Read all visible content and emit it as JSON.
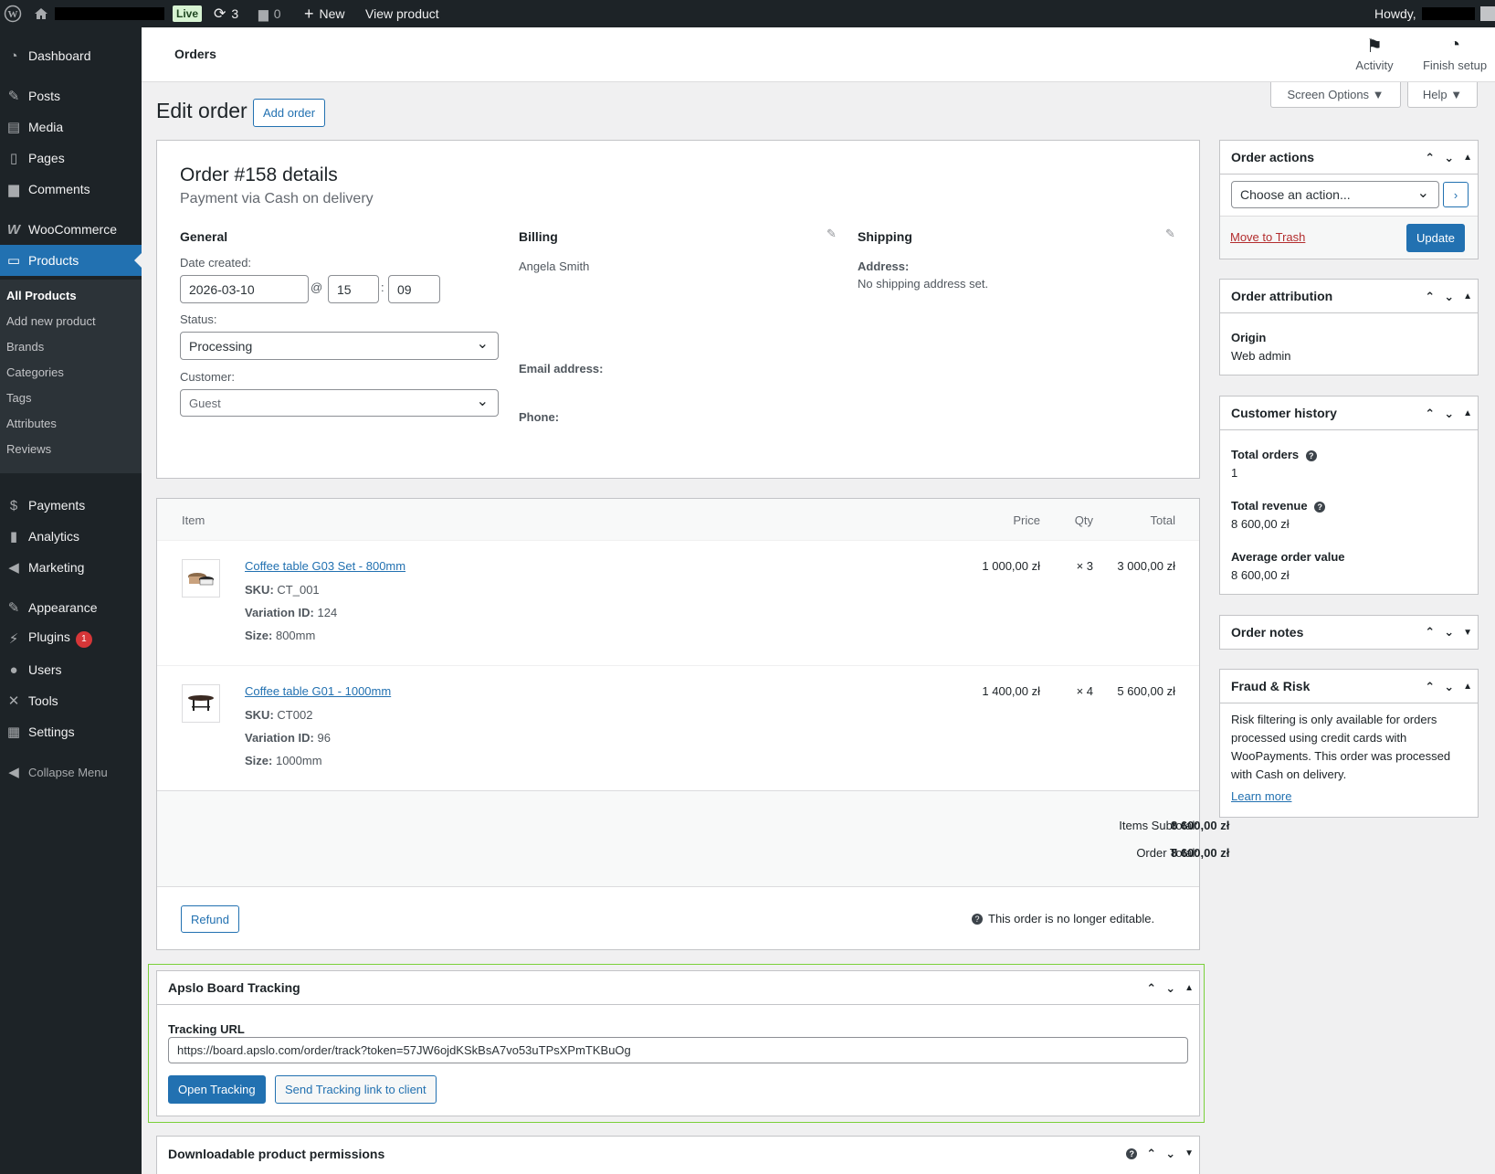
{
  "adminbar": {
    "live_label": "Live",
    "updates_count": "3",
    "comments_count": "0",
    "new_label": "New",
    "view_product_label": "View product",
    "howdy_label": "Howdy,"
  },
  "sidebar": {
    "dashboard": "Dashboard",
    "posts": "Posts",
    "media": "Media",
    "pages": "Pages",
    "comments": "Comments",
    "woocommerce": "WooCommerce",
    "products": "Products",
    "submenu": {
      "all_products": "All Products",
      "add_new": "Add new product",
      "brands": "Brands",
      "categories": "Categories",
      "tags": "Tags",
      "attributes": "Attributes",
      "reviews": "Reviews"
    },
    "payments": "Payments",
    "analytics": "Analytics",
    "marketing": "Marketing",
    "appearance": "Appearance",
    "plugins": "Plugins",
    "plugins_badge": "1",
    "users": "Users",
    "tools": "Tools",
    "settings": "Settings",
    "collapse": "Collapse Menu"
  },
  "header": {
    "title": "Orders",
    "activity": "Activity",
    "finish_setup": "Finish setup",
    "screen_options": "Screen Options ▼",
    "help": "Help ▼"
  },
  "page": {
    "heading": "Edit order",
    "add_order": "Add order"
  },
  "order": {
    "title": "Order #158 details",
    "payment": "Payment via Cash on delivery",
    "general": {
      "heading": "General",
      "date_label": "Date created:",
      "date": "2026-03-10",
      "at": "@",
      "hour": "15",
      "colon": ":",
      "minute": "09",
      "status_label": "Status:",
      "status": "Processing",
      "customer_label": "Customer:",
      "customer": "Guest"
    },
    "billing": {
      "heading": "Billing",
      "name": "Angela Smith",
      "email_label": "Email address:",
      "phone_label": "Phone:"
    },
    "shipping": {
      "heading": "Shipping",
      "address_label": "Address:",
      "address": "No shipping address set."
    }
  },
  "items": {
    "headers": {
      "item": "Item",
      "price": "Price",
      "qty": "Qty",
      "total": "Total"
    },
    "rows": [
      {
        "name": "Coffee table G03 Set - 800mm",
        "sku_label": "SKU:",
        "sku": "CT_001",
        "variation_label": "Variation ID:",
        "variation": "124",
        "size_label": "Size:",
        "size": "800mm",
        "price": "1 000,00 zł",
        "qty": "× 3",
        "total": "3 000,00 zł"
      },
      {
        "name": "Coffee table G01 - 1000mm",
        "sku_label": "SKU:",
        "sku": "CT002",
        "variation_label": "Variation ID:",
        "variation": "96",
        "size_label": "Size:",
        "size": "1000mm",
        "price": "1 400,00 zł",
        "qty": "× 4",
        "total": "5 600,00 zł"
      }
    ],
    "subtotal_label": "Items Subtotal:",
    "subtotal": "8 600,00 zł",
    "order_total_label": "Order Total:",
    "order_total": "8 600,00 zł",
    "refund": "Refund",
    "not_editable": "This order is no longer editable."
  },
  "tracking": {
    "title": "Apslo Board Tracking",
    "url_label": "Tracking URL",
    "url": "https://board.apslo.com/order/track?token=57JW6ojdKSkBsA7vo53uTPsXPmTKBuOg",
    "open": "Open Tracking",
    "send": "Send Tracking link to client"
  },
  "downloads": {
    "title": "Downloadable product permissions"
  },
  "order_actions": {
    "title": "Order actions",
    "choose": "Choose an action...",
    "trash": "Move to Trash",
    "update": "Update"
  },
  "attribution": {
    "title": "Order attribution",
    "origin_label": "Origin",
    "origin": "Web admin"
  },
  "history": {
    "title": "Customer history",
    "total_orders_label": "Total orders",
    "total_orders": "1",
    "total_revenue_label": "Total revenue",
    "total_revenue": "8 600,00 zł",
    "aov_label": "Average order value",
    "aov": "8 600,00 zł"
  },
  "notes": {
    "title": "Order notes"
  },
  "fraud": {
    "title": "Fraud & Risk",
    "text": "Risk filtering is only available for orders processed using credit cards with WooPayments. This order was processed with Cash on delivery.",
    "learn_more": "Learn more"
  },
  "colors": {
    "accent": "#2271b1",
    "sidebar": "#1d2327",
    "tracking_border": "#7ad03a",
    "trash": "#b32d2e"
  }
}
